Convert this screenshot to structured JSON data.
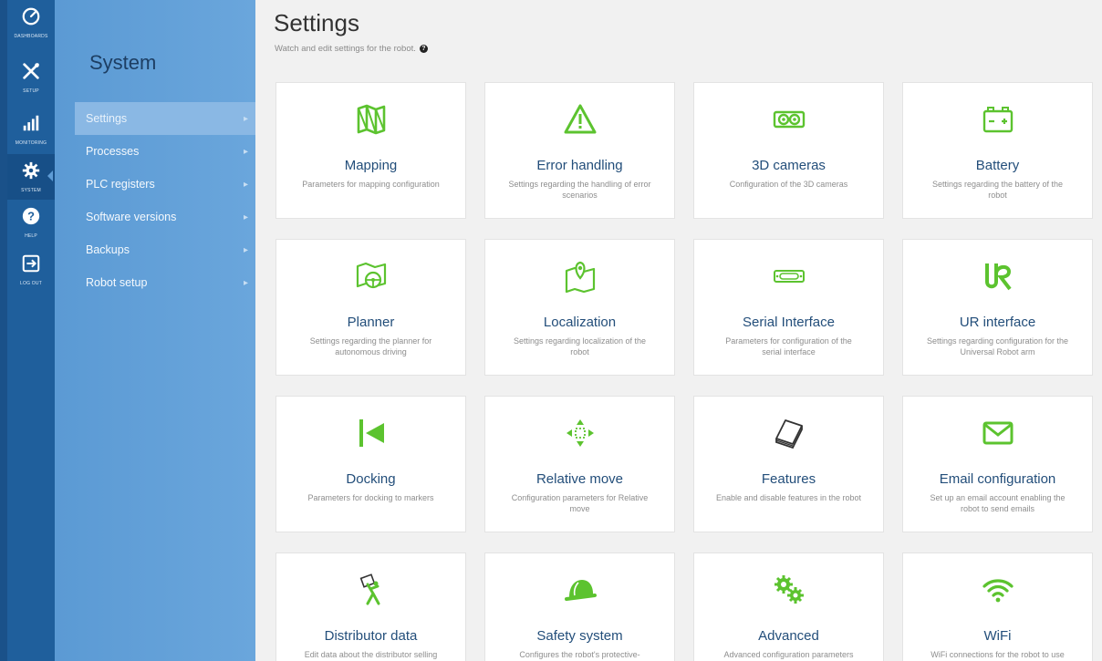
{
  "rail": {
    "items": [
      {
        "label": "DASHBOARDS",
        "icon": "gauge-icon"
      },
      {
        "label": "SETUP",
        "icon": "tools-icon"
      },
      {
        "label": "MONITORING",
        "icon": "signal-bars-icon"
      },
      {
        "label": "SYSTEM",
        "icon": "gear-icon"
      },
      {
        "label": "HELP",
        "icon": "question-icon"
      },
      {
        "label": "LOG OUT",
        "icon": "logout-icon"
      }
    ],
    "active": "SYSTEM"
  },
  "sidebar": {
    "title": "System",
    "items": [
      {
        "label": "Settings",
        "active": true
      },
      {
        "label": "Processes"
      },
      {
        "label": "PLC registers"
      },
      {
        "label": "Software versions"
      },
      {
        "label": "Backups"
      },
      {
        "label": "Robot setup"
      }
    ]
  },
  "header": {
    "title": "Settings",
    "subtitle": "Watch and edit settings for the robot."
  },
  "colors": {
    "accent_green": "#5cc32f",
    "title_blue": "#234e7a",
    "rail_blue": "#1f5f9c"
  },
  "cards": [
    {
      "title": "Mapping",
      "desc": "Parameters for mapping configuration",
      "icon": "map-icon"
    },
    {
      "title": "Error handling",
      "desc": "Settings regarding the handling of error scenarios",
      "icon": "warning-icon"
    },
    {
      "title": "3D cameras",
      "desc": "Configuration of the 3D cameras",
      "icon": "camera-icon"
    },
    {
      "title": "Battery",
      "desc": "Settings regarding the battery of the robot",
      "icon": "battery-icon"
    },
    {
      "title": "Planner",
      "desc": "Settings regarding the planner for autonomous driving",
      "icon": "planner-icon"
    },
    {
      "title": "Localization",
      "desc": "Settings regarding localization of the robot",
      "icon": "map-pin-icon"
    },
    {
      "title": "Serial Interface",
      "desc": "Parameters for configuration of the serial interface",
      "icon": "serial-port-icon"
    },
    {
      "title": "UR interface",
      "desc": "Settings regarding configuration for the Universal Robot arm",
      "icon": "ur-logo-icon"
    },
    {
      "title": "Docking",
      "desc": "Parameters for docking to markers",
      "icon": "docking-icon"
    },
    {
      "title": "Relative move",
      "desc": "Configuration parameters for Relative move",
      "icon": "move-arrows-icon"
    },
    {
      "title": "Features",
      "desc": "Enable and disable features in the robot",
      "icon": "stack-icon"
    },
    {
      "title": "Email configuration",
      "desc": "Set up an email account enabling the robot to send emails",
      "icon": "envelope-icon"
    },
    {
      "title": "Distributor data",
      "desc": "Edit data about the distributor selling",
      "icon": "person-sign-icon"
    },
    {
      "title": "Safety system",
      "desc": "Configures the robot's protective-",
      "icon": "helmet-icon"
    },
    {
      "title": "Advanced",
      "desc": "Advanced configuration parameters",
      "icon": "gears-icon"
    },
    {
      "title": "WiFi",
      "desc": "WiFi connections for the robot to use",
      "icon": "wifi-icon"
    }
  ]
}
